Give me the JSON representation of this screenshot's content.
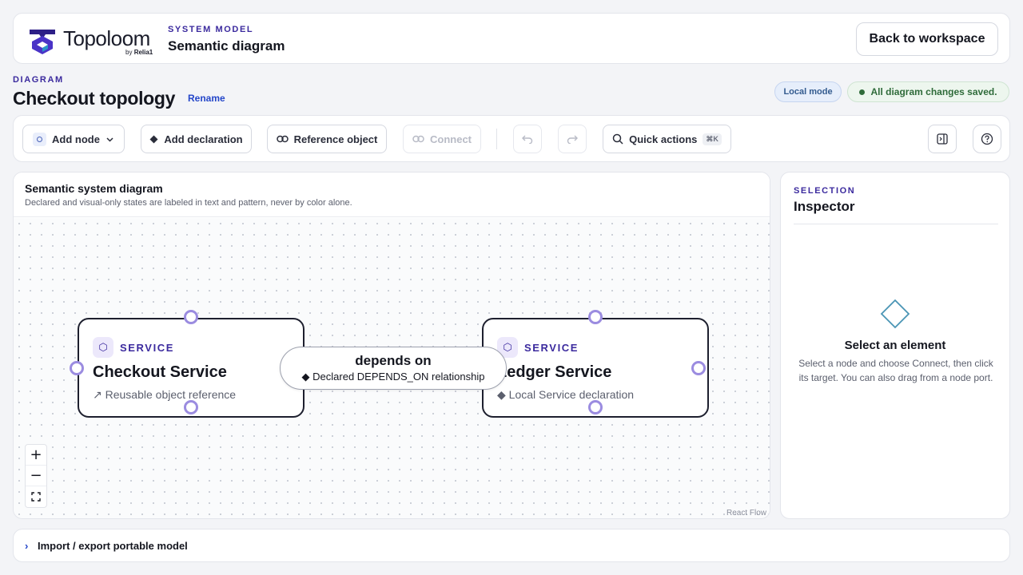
{
  "header": {
    "brand": "Topoloom",
    "brand_by": "by",
    "brand_parent": "Relia1",
    "eyebrow": "SYSTEM MODEL",
    "title": "Semantic diagram",
    "back_label": "Back to workspace"
  },
  "diagram": {
    "eyebrow": "DIAGRAM",
    "title": "Checkout topology",
    "rename_label": "Rename",
    "mode_badge": "Local mode",
    "save_status": "All diagram changes saved."
  },
  "toolbar": {
    "add_node": "Add node",
    "add_declaration": "Add declaration",
    "reference_object": "Reference object",
    "connect": "Connect",
    "quick_actions": "Quick actions",
    "quick_actions_shortcut": "⌘K"
  },
  "canvas": {
    "title": "Semantic system diagram",
    "subtitle": "Declared and visual-only states are labeled in text and pattern, never by color alone.",
    "attribution": "React Flow",
    "nodes": [
      {
        "type": "SERVICE",
        "name": "Checkout Service",
        "meta_icon": "↗",
        "meta": "Reusable object reference"
      },
      {
        "type": "SERVICE",
        "name": "Ledger Service",
        "meta_icon": "◆",
        "meta": "Local Service declaration"
      }
    ],
    "edge": {
      "title": "depends on",
      "subtitle_icon": "◆",
      "subtitle": "Declared DEPENDS_ON relationship"
    },
    "zoom": {
      "in": "+",
      "out": "−",
      "fit": "⛶"
    }
  },
  "inspector": {
    "eyebrow": "SELECTION",
    "title": "Inspector",
    "empty_title": "Select an element",
    "empty_body": "Select a node and choose Connect, then click its target. You can also drag from a node port."
  },
  "import_export": {
    "chevron": "›",
    "label": "Import / export portable model"
  },
  "colors": {
    "accent": "#3b2a9e",
    "link": "#2446c9",
    "port": "#9b8ce0",
    "saved": "#2f6b3a",
    "inspector_icon": "#4a95b5"
  }
}
